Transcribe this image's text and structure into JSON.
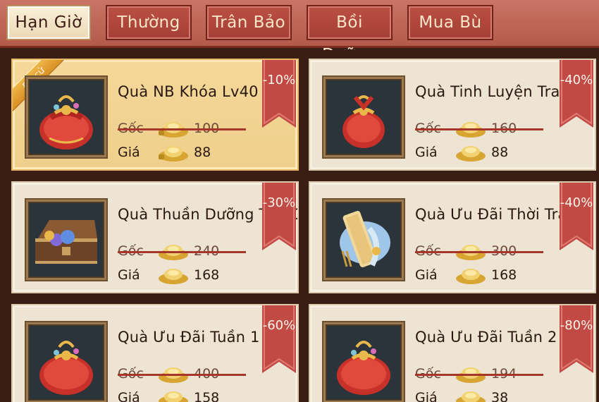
{
  "tabs": [
    "Hạn Giờ",
    "Thường",
    "Trân Bảo",
    "Bồi Dưỡng",
    "Mua Bù"
  ],
  "active_tab": 0,
  "labels": {
    "original": "Gốc",
    "price": "Giá"
  },
  "items": [
    {
      "name": "Quà NB Khóa Lv40",
      "discount": "-10%",
      "original": "100",
      "price": "88",
      "badge": "Đề cử",
      "icon": "red-gift-bag-icon",
      "highlighted": true
    },
    {
      "name": "Quà Tinh Luyện Trang Bị",
      "discount": "-40%",
      "original": "160",
      "price": "88",
      "icon": "red-gift-bag-icon"
    },
    {
      "name": "Quà Thuần Dưỡng Thú Cưng",
      "discount": "-30%",
      "original": "240",
      "price": "168",
      "icon": "treasure-chest-icon"
    },
    {
      "name": "Quà Ưu Đãi Thời Trang",
      "discount": "-40%",
      "original": "300",
      "price": "168",
      "icon": "fashion-scroll-icon"
    },
    {
      "name": "Quà Ưu Đãi Tuần 1",
      "discount": "-60%",
      "original": "400",
      "price": "158",
      "icon": "red-gift-bag-icon"
    },
    {
      "name": "Quà Ưu Đãi Tuần 2",
      "discount": "-80%",
      "original": "194",
      "price": "38",
      "icon": "red-gift-bag-icon"
    }
  ],
  "colors": {
    "tab_active_bg": "#f5e6c8",
    "tab_bg": "#b54a40",
    "ribbon": "#c24a45",
    "highlight_card": "#f3d695",
    "card": "#ede4d3"
  }
}
